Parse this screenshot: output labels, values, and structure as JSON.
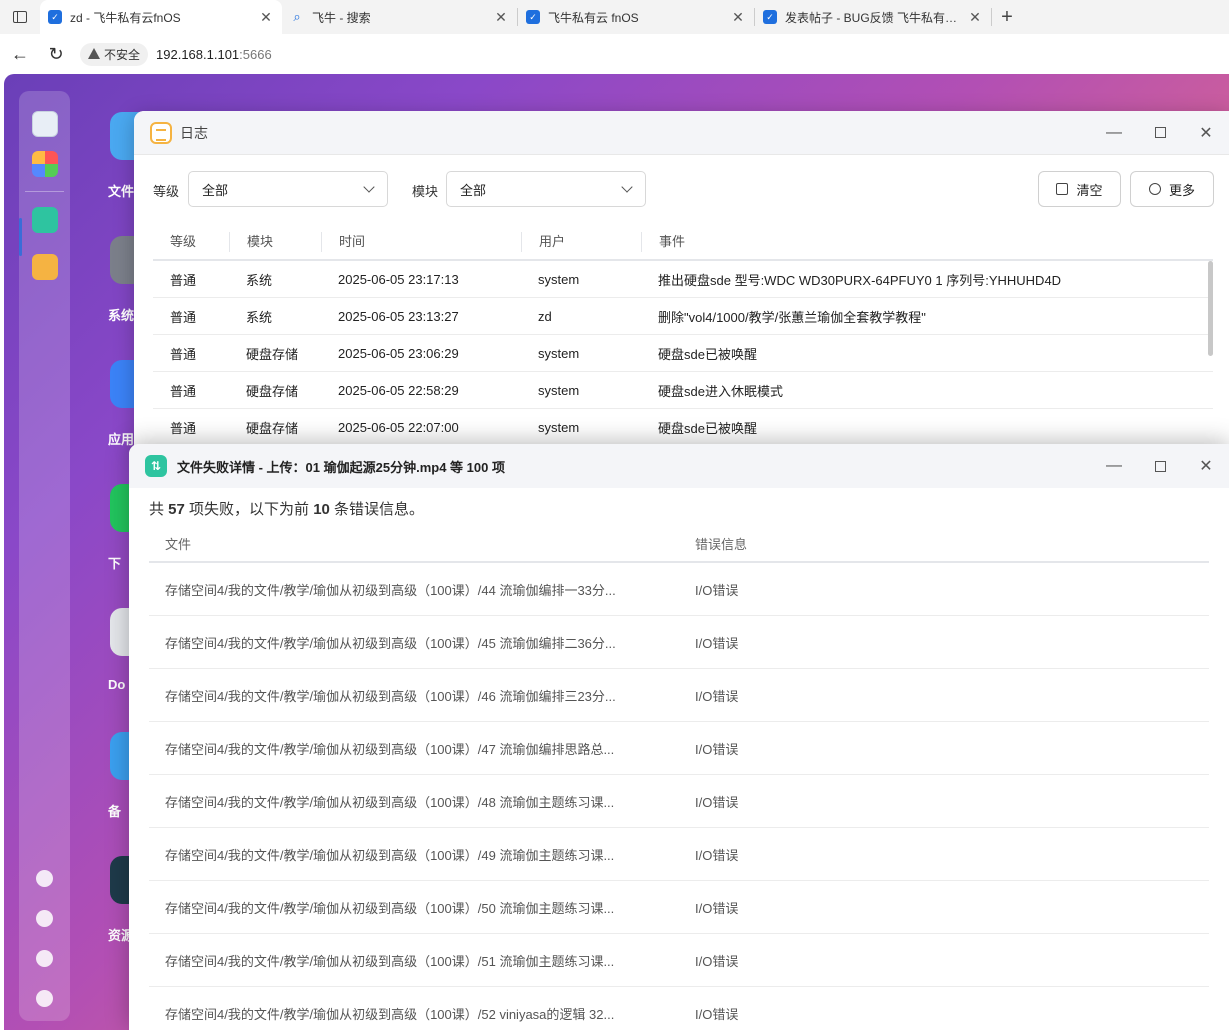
{
  "browser": {
    "tabs": [
      {
        "title": "zd - 飞牛私有云fnOS",
        "active": true,
        "icon": "fnos-favicon"
      },
      {
        "title": "飞牛 - 搜索",
        "active": false,
        "icon": "search-favicon"
      },
      {
        "title": "飞牛私有云 fnOS",
        "active": false,
        "icon": "fnos-favicon"
      },
      {
        "title": "发表帖子 - BUG反馈 飞牛私有云论坛",
        "active": false,
        "icon": "fnos-favicon"
      }
    ],
    "new_tab": "+",
    "insecure_label": "不安全",
    "url_host": "192.168.1.101",
    "url_port": ":5666"
  },
  "desktop": {
    "apps": [
      "文件",
      "系统",
      "应用",
      "下",
      "Do",
      "备",
      "资源"
    ]
  },
  "log_window": {
    "title": "日志",
    "filters": {
      "level_label": "等级",
      "level_value": "全部",
      "module_label": "模块",
      "module_value": "全部"
    },
    "buttons": {
      "clear": "清空",
      "more": "更多"
    },
    "columns": [
      "等级",
      "模块",
      "时间",
      "用户",
      "事件"
    ],
    "rows": [
      {
        "level": "普通",
        "module": "系统",
        "time": "2025-06-05 23:17:13",
        "user": "system",
        "event": "推出硬盘sde 型号:WDC WD30PURX-64PFUY0 1 序列号:YHHUHD4D"
      },
      {
        "level": "普通",
        "module": "系统",
        "time": "2025-06-05 23:13:27",
        "user": "zd",
        "event": "删除\"vol4/1000/教学/张蕙兰瑜伽全套教学教程\""
      },
      {
        "level": "普通",
        "module": "硬盘存储",
        "time": "2025-06-05 23:06:29",
        "user": "system",
        "event": "硬盘sde已被唤醒"
      },
      {
        "level": "普通",
        "module": "硬盘存储",
        "time": "2025-06-05 22:58:29",
        "user": "system",
        "event": "硬盘sde进入休眠模式"
      },
      {
        "level": "普通",
        "module": "硬盘存储",
        "time": "2025-06-05 22:07:00",
        "user": "system",
        "event": "硬盘sde已被唤醒"
      }
    ]
  },
  "fail_window": {
    "title": "文件失败详情 - 上传：01 瑜伽起源25分钟.mp4 等 100 项",
    "summary": {
      "prefix": "共 ",
      "total": "57",
      "mid": " 项失败，以下为前 ",
      "shown": "10",
      "suffix": " 条错误信息。"
    },
    "columns": [
      "文件",
      "错误信息"
    ],
    "rows": [
      {
        "file": "存储空间4/我的文件/教学/瑜伽从初级到高级（100课）/44 流瑜伽编排一33分...",
        "error": "I/O错误"
      },
      {
        "file": "存储空间4/我的文件/教学/瑜伽从初级到高级（100课）/45 流瑜伽编排二36分...",
        "error": "I/O错误"
      },
      {
        "file": "存储空间4/我的文件/教学/瑜伽从初级到高级（100课）/46 流瑜伽编排三23分...",
        "error": "I/O错误"
      },
      {
        "file": "存储空间4/我的文件/教学/瑜伽从初级到高级（100课）/47 流瑜伽编排思路总...",
        "error": "I/O错误"
      },
      {
        "file": "存储空间4/我的文件/教学/瑜伽从初级到高级（100课）/48 流瑜伽主题练习课...",
        "error": "I/O错误"
      },
      {
        "file": "存储空间4/我的文件/教学/瑜伽从初级到高级（100课）/49 流瑜伽主题练习课...",
        "error": "I/O错误"
      },
      {
        "file": "存储空间4/我的文件/教学/瑜伽从初级到高级（100课）/50 流瑜伽主题练习课...",
        "error": "I/O错误"
      },
      {
        "file": "存储空间4/我的文件/教学/瑜伽从初级到高级（100课）/51 流瑜伽主题练习课...",
        "error": "I/O错误"
      },
      {
        "file": "存储空间4/我的文件/教学/瑜伽从初级到高级（100课）/52 viniyasa的逻辑 32...",
        "error": "I/O错误"
      }
    ]
  }
}
